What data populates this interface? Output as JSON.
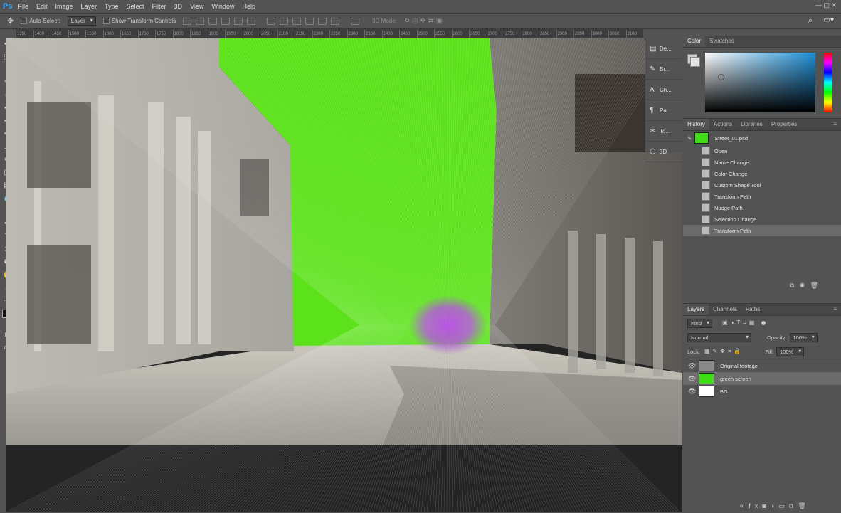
{
  "app": {
    "logo": "Ps"
  },
  "menu": [
    "File",
    "Edit",
    "Image",
    "Layer",
    "Type",
    "Select",
    "Filter",
    "3D",
    "View",
    "Window",
    "Help"
  ],
  "options": {
    "auto_select_label": "Auto-Select:",
    "auto_select_value": "Layer",
    "transform_controls_label": "Show Transform Controls",
    "mode_label": "3D Mode:"
  },
  "ruler_ticks": [
    "1350",
    "1400",
    "1450",
    "1500",
    "1550",
    "1600",
    "1650",
    "1700",
    "1750",
    "1800",
    "1850",
    "1900",
    "1950",
    "2000",
    "2050",
    "2100",
    "2150",
    "2200",
    "2250",
    "2300",
    "2350",
    "2400",
    "2450",
    "2500",
    "2550",
    "2600",
    "2650",
    "2700",
    "2750",
    "2800",
    "2850",
    "2900",
    "2950",
    "3000",
    "3050",
    "3100"
  ],
  "collapsed_panels": [
    {
      "label": "De...",
      "icon": "device-preview-icon"
    },
    {
      "label": "Br...",
      "icon": "brush-icon"
    },
    {
      "label": "Ch...",
      "icon": "character-icon"
    },
    {
      "label": "Pa...",
      "icon": "paragraph-icon"
    },
    {
      "label": "To...",
      "icon": "tool-presets-icon"
    },
    {
      "label": "3D",
      "icon": "3d-icon"
    }
  ],
  "color_panel": {
    "tabs": [
      "Color",
      "Swatches"
    ],
    "active": "Color",
    "accent": "#1e8fd6"
  },
  "history_panel": {
    "tabs": [
      "History",
      "Actions",
      "Libraries",
      "Properties"
    ],
    "snapshot": "Street_01.psd",
    "items": [
      "Open",
      "Name Change",
      "Color Change",
      "Custom Shape Tool",
      "Transform Path",
      "Nudge Path",
      "Selection Change",
      "Transform Path"
    ]
  },
  "layers_panel": {
    "tabs": [
      "Layers",
      "Channels",
      "Paths"
    ],
    "filter_label": "Kind",
    "blend_mode": "Normal",
    "opacity_label": "Opacity:",
    "opacity_value": "100%",
    "lock_label": "Lock:",
    "fill_label": "Fill:",
    "fill_value": "100%",
    "layers": [
      {
        "name": "Original footage",
        "thumb": "#8a8a8a"
      },
      {
        "name": "green screen",
        "thumb": "#3fdc16"
      },
      {
        "name": "BG",
        "thumb": "#ffffff"
      }
    ]
  },
  "colors": {
    "green_screen": "#5ce21a",
    "magenta": "#b13be0"
  }
}
